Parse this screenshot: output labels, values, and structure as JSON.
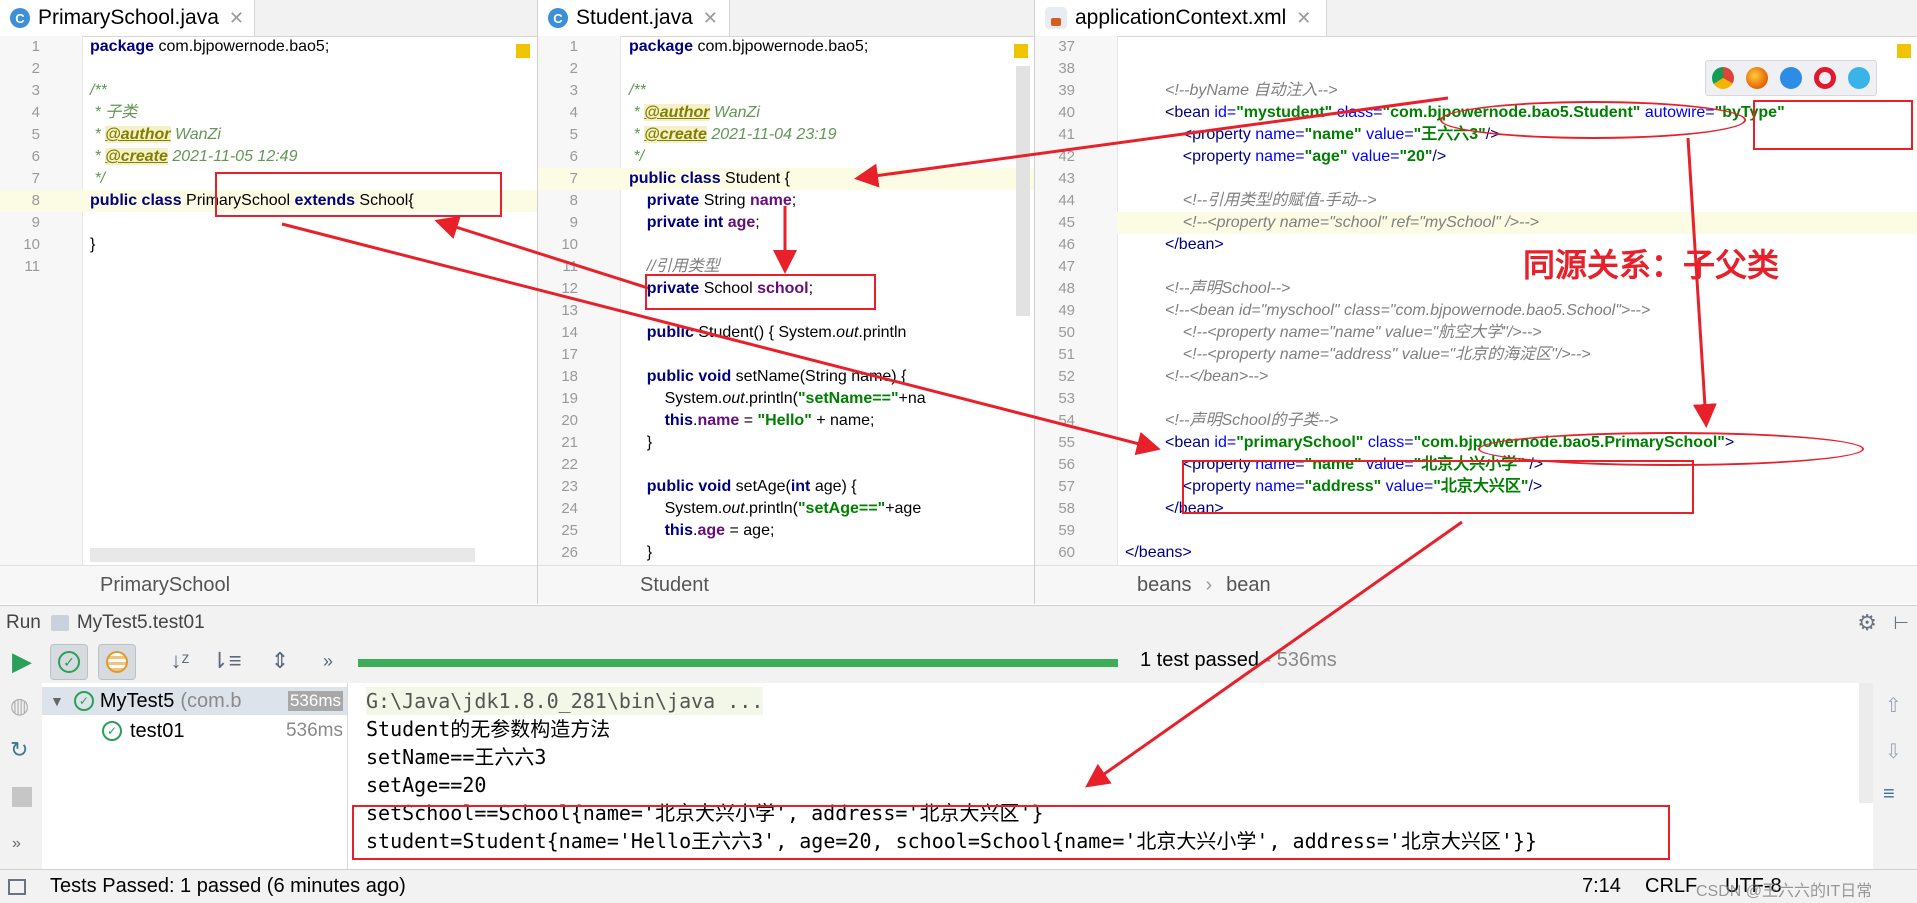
{
  "tabs": {
    "pane1": {
      "label": "PrimarySchool.java"
    },
    "pane2": {
      "label": "Student.java"
    },
    "pane3": {
      "label": "applicationContext.xml"
    }
  },
  "pane1": {
    "breadcrumb": "PrimarySchool",
    "line_numbers": [
      "1",
      "2",
      "3",
      "4",
      "5",
      "6",
      "7",
      "8",
      "9",
      "10",
      "11"
    ]
  },
  "pane2": {
    "breadcrumb": "Student",
    "line_numbers": [
      "1",
      "2",
      "3",
      "4",
      "5",
      "6",
      "7",
      "8",
      "9",
      "10",
      "11",
      "12",
      "13",
      "14",
      "17",
      "18",
      "19",
      "20",
      "21",
      "22",
      "23",
      "24",
      "25",
      "26"
    ]
  },
  "pane3": {
    "breadcrumb": [
      "beans",
      "bean"
    ],
    "line_numbers": [
      "37",
      "38",
      "39",
      "40",
      "41",
      "42",
      "43",
      "44",
      "45",
      "46",
      "47",
      "48",
      "49",
      "50",
      "51",
      "52",
      "53",
      "54",
      "55",
      "56",
      "57",
      "58",
      "59",
      "60"
    ]
  },
  "annotation": {
    "text": "同源关系：子父类",
    "color": "#e8202a"
  },
  "run": {
    "title": "Run",
    "config": "MyTest5.test01",
    "progress": 1.0,
    "progress_color": "#3cae5a",
    "summary": "1 test passed",
    "summary_time": " - 536ms",
    "tree": [
      {
        "name": "MyTest5",
        "detail": "(com.b",
        "time": "536ms"
      },
      {
        "name": "test01",
        "detail": "",
        "time": "536ms"
      }
    ],
    "console": [
      "G:\\Java\\jdk1.8.0_281\\bin\\java ...",
      "Student的无参数构造方法",
      "setName==王六六3",
      "setAge==20",
      "setSchool==School{name='北京大兴小学', address='北京大兴区'}",
      "student=Student{name='Hello王六六3', age=20, school=School{name='北京大兴小学', address='北京大兴区'}}"
    ]
  },
  "status": {
    "message": "Tests Passed: 1 passed (6 minutes ago)",
    "position": "7:14",
    "line_sep": "CRLF",
    "encoding": "UTF-8",
    "watermark": "CSDN @王六六的IT日常"
  },
  "colors": {
    "accent_red": "#e8202a",
    "keyword": "#000080",
    "string": "#008000",
    "doc_comment": "#629755"
  }
}
